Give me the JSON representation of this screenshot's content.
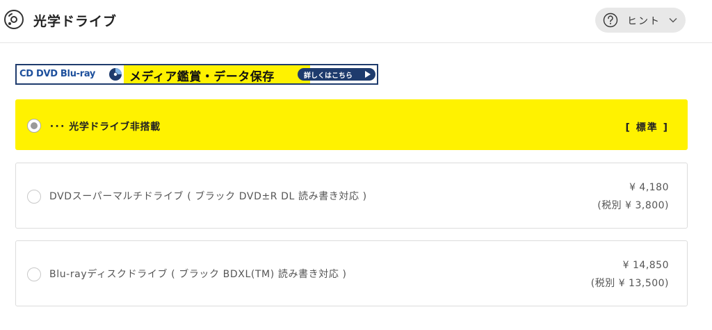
{
  "header": {
    "title": "光学ドライブ",
    "hint_label": "ヒント"
  },
  "banner": {
    "left_text": "CD DVD Blu-ray",
    "main_text": "メディア鑑賞・データ保存",
    "button_text": "詳しくはこちら"
  },
  "options": [
    {
      "label": "･･･ 光学ドライブ非搭載",
      "standard": "[ 標準 ]",
      "selected": true
    },
    {
      "label": "DVDスーパーマルチドライブ ( ブラック DVD±R DL 読み書き対応 )",
      "price": "¥ 4,180",
      "price_tax": "(税別 ¥ 3,800)",
      "selected": false
    },
    {
      "label": "Blu-rayディスクドライブ ( ブラック BDXL(TM) 読み書き対応 )",
      "price": "¥ 14,850",
      "price_tax": "(税別 ¥ 13,500)",
      "selected": false
    }
  ],
  "colors": {
    "selected_bg": "#fff200",
    "banner_navy": "#1e3b6d",
    "banner_blue_text": "#1d4f9c"
  },
  "icons": [
    "disc-icon",
    "question-circle-icon",
    "chevron-down-icon",
    "cd-icon",
    "play-arrow-icon"
  ]
}
